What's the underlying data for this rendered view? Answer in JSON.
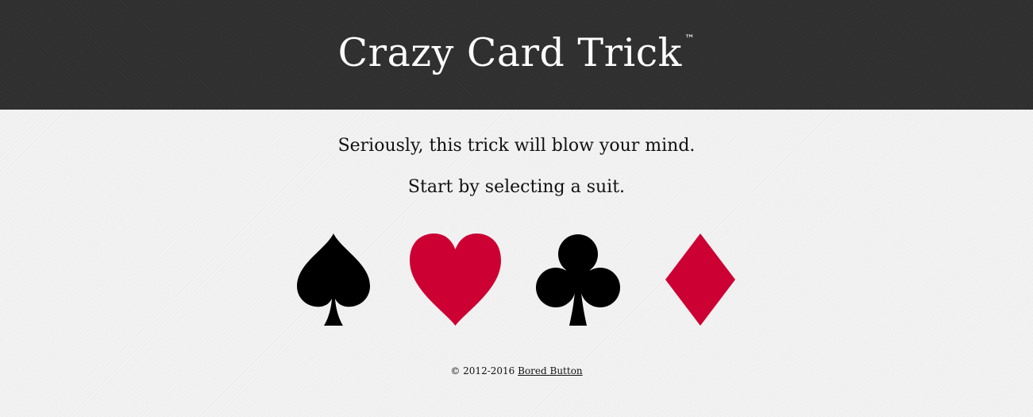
{
  "header": {
    "title": "Crazy Card Trick",
    "trademark": "™",
    "background": "#2f2f2f"
  },
  "main": {
    "line1": "Seriously, this trick will blow your mind.",
    "line2": "Start by selecting a suit."
  },
  "suits": [
    {
      "name": "spade",
      "icon": "spade-icon",
      "color": "#000000"
    },
    {
      "name": "heart",
      "icon": "heart-icon",
      "color": "#cc0033"
    },
    {
      "name": "club",
      "icon": "club-icon",
      "color": "#000000"
    },
    {
      "name": "diamond",
      "icon": "diamond-icon",
      "color": "#cc0033"
    }
  ],
  "footer": {
    "copyright": "© 2012-2016",
    "link_label": "Bored Button"
  }
}
